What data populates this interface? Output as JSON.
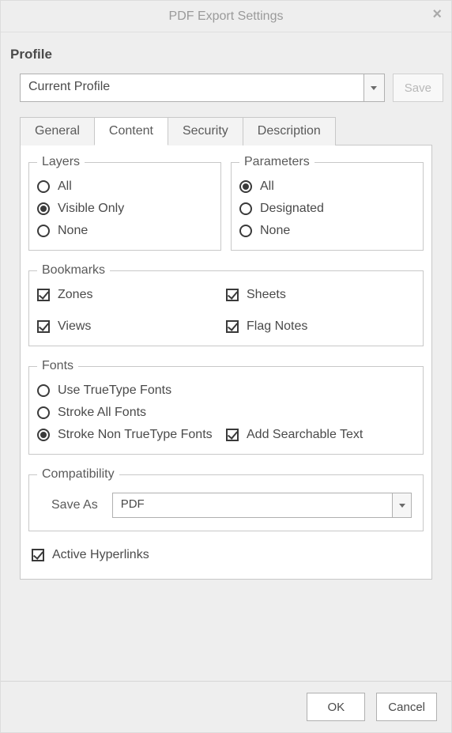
{
  "window": {
    "title": "PDF Export Settings",
    "close_icon": "×"
  },
  "profile": {
    "label": "Profile",
    "selected": "Current Profile",
    "save_label": "Save"
  },
  "tabs": {
    "general": "General",
    "content": "Content",
    "security": "Security",
    "description": "Description",
    "active": "content"
  },
  "content_tab": {
    "layers": {
      "legend": "Layers",
      "all": "All",
      "visible_only": "Visible Only",
      "none": "None",
      "selected": "visible_only"
    },
    "parameters": {
      "legend": "Parameters",
      "all": "All",
      "designated": "Designated",
      "none": "None",
      "selected": "all"
    },
    "bookmarks": {
      "legend": "Bookmarks",
      "zones": {
        "label": "Zones",
        "checked": true
      },
      "sheets": {
        "label": "Sheets",
        "checked": true
      },
      "views": {
        "label": "Views",
        "checked": true
      },
      "flag_notes": {
        "label": "Flag Notes",
        "checked": true
      }
    },
    "fonts": {
      "legend": "Fonts",
      "truetype": "Use TrueType Fonts",
      "stroke_all": "Stroke All Fonts",
      "stroke_non_tt": "Stroke Non TrueType Fonts",
      "add_searchable": "Add Searchable Text",
      "selected": "stroke_non_tt",
      "add_searchable_checked": true
    },
    "compatibility": {
      "legend": "Compatibility",
      "saveas_label": "Save As",
      "saveas_value": "PDF"
    },
    "active_hyperlinks": {
      "label": "Active Hyperlinks",
      "checked": true
    }
  },
  "footer": {
    "ok": "OK",
    "cancel": "Cancel"
  }
}
